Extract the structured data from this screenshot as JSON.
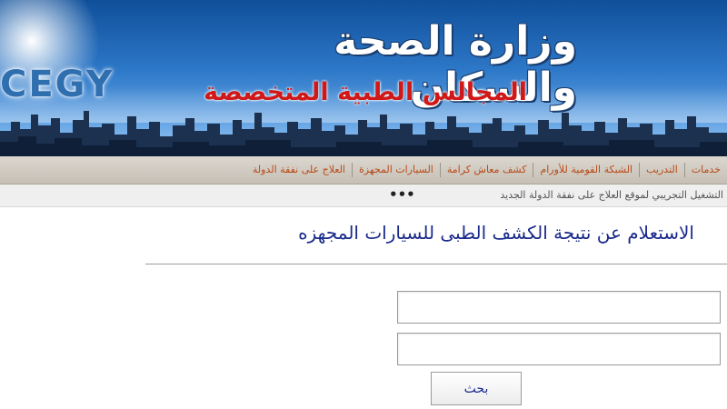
{
  "header": {
    "logo_text": "CEGY",
    "title": "وزارة الصحة والسكان",
    "subtitle": "المجالس الطبية المتخصصة"
  },
  "nav": {
    "items": [
      "العلاج على نفقة الدولة",
      "السيارات المجهزة",
      "كشف معاش كرامة",
      "الشبكة القومية للأورام",
      "التدريب",
      "خدمات"
    ]
  },
  "ticker": {
    "text": "التشغيل التجريبي لموقع العلاج على نفقة الدولة الجديد",
    "dots": "•••"
  },
  "main": {
    "title": "الاستعلام عن نتيجة الكشف الطبى للسيارات المجهزه",
    "search_button": "بحث"
  },
  "colors": {
    "nav_text": "#b84a18",
    "title_text": "#1a2a8a",
    "subtitle_red": "#d01818"
  }
}
